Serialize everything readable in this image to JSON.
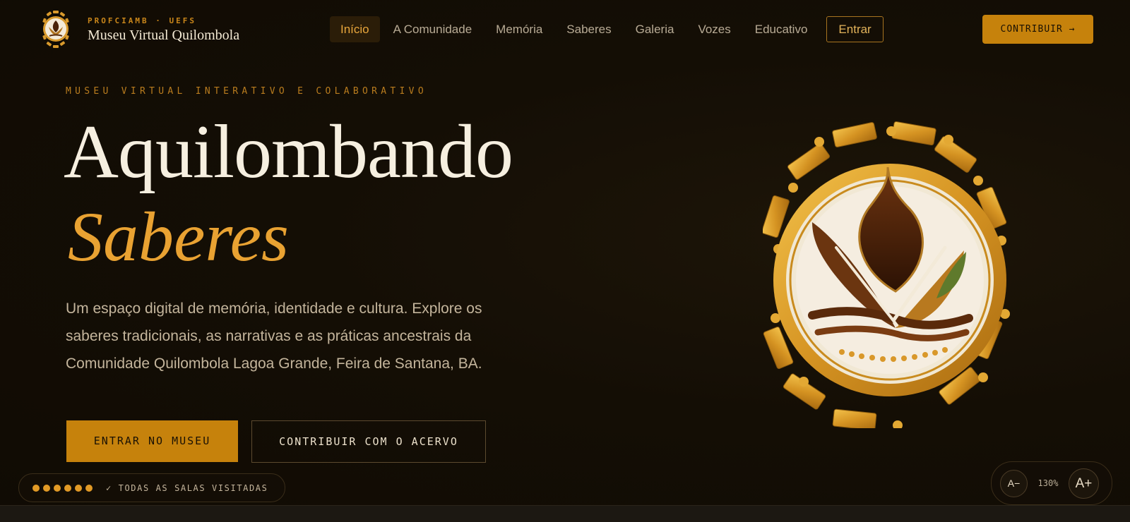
{
  "brand": {
    "subtitle": "PROFCIAMB · UEFS",
    "title": "Museu Virtual Quilombola"
  },
  "nav": {
    "items": [
      {
        "label": "Início",
        "active": true
      },
      {
        "label": "A Comunidade"
      },
      {
        "label": "Memória"
      },
      {
        "label": "Saberes"
      },
      {
        "label": "Galeria"
      },
      {
        "label": "Vozes"
      },
      {
        "label": "Educativo"
      }
    ],
    "enter_label": "Entrar",
    "contribute_label": "CONTRIBUIR →"
  },
  "hero": {
    "eyebrow": "MUSEU VIRTUAL INTERATIVO E COLABORATIVO",
    "title_line1": "Aquilombando",
    "title_line2": "Saberes",
    "description": "Um espaço digital de memória, identidade e cultura. Explore os saberes tradicionais, as narrativas e as práticas ancestrais da Comunidade Quilombola Lagoa Grande, Feira de Santana, BA.",
    "primary_button": "ENTRAR NO MUSEU",
    "secondary_button": "CONTRIBUIR COM O ACERVO"
  },
  "progress": {
    "rooms_visited": 6,
    "rooms_total": 6,
    "label": "✓ TODAS AS SALAS VISITADAS"
  },
  "zoom": {
    "decrease_label": "A−",
    "value": "130%",
    "increase_label": "A+"
  },
  "colors": {
    "accent": "#c6820c",
    "accent_light": "#e9a232",
    "background": "#140e05",
    "text": "#f6efe0"
  }
}
